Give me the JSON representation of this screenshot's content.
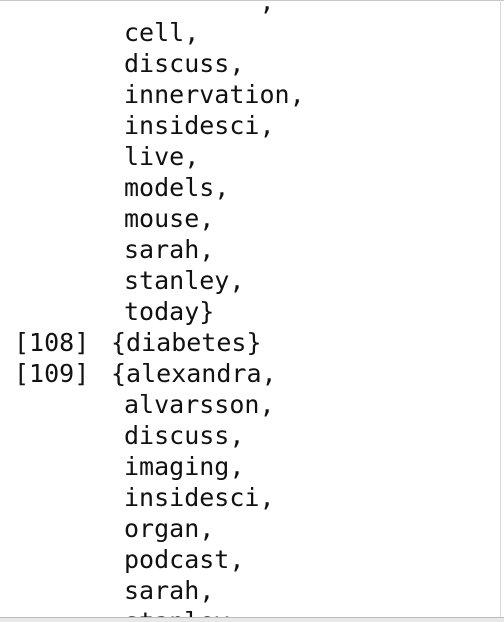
{
  "output": {
    "lines": [
      {
        "index": "",
        "text": "         ,"
      },
      {
        "index": "",
        "text": "cell,"
      },
      {
        "index": "",
        "text": "discuss,"
      },
      {
        "index": "",
        "text": "innervation,"
      },
      {
        "index": "",
        "text": "insidesci,"
      },
      {
        "index": "",
        "text": "live,"
      },
      {
        "index": "",
        "text": "models,"
      },
      {
        "index": "",
        "text": "mouse,"
      },
      {
        "index": "",
        "text": "sarah,"
      },
      {
        "index": "",
        "text": "stanley,"
      },
      {
        "index": "",
        "text": "today}"
      },
      {
        "index": "[108]",
        "text": "{diabetes}"
      },
      {
        "index": "[109]",
        "text": "{alexandra,"
      },
      {
        "index": "",
        "text": "alvarsson,"
      },
      {
        "index": "",
        "text": "discuss,"
      },
      {
        "index": "",
        "text": "imaging,"
      },
      {
        "index": "",
        "text": "insidesci,"
      },
      {
        "index": "",
        "text": "organ,"
      },
      {
        "index": "",
        "text": "podcast,"
      },
      {
        "index": "",
        "text": "sarah,"
      },
      {
        "index": "",
        "text": "stanley,"
      }
    ]
  }
}
